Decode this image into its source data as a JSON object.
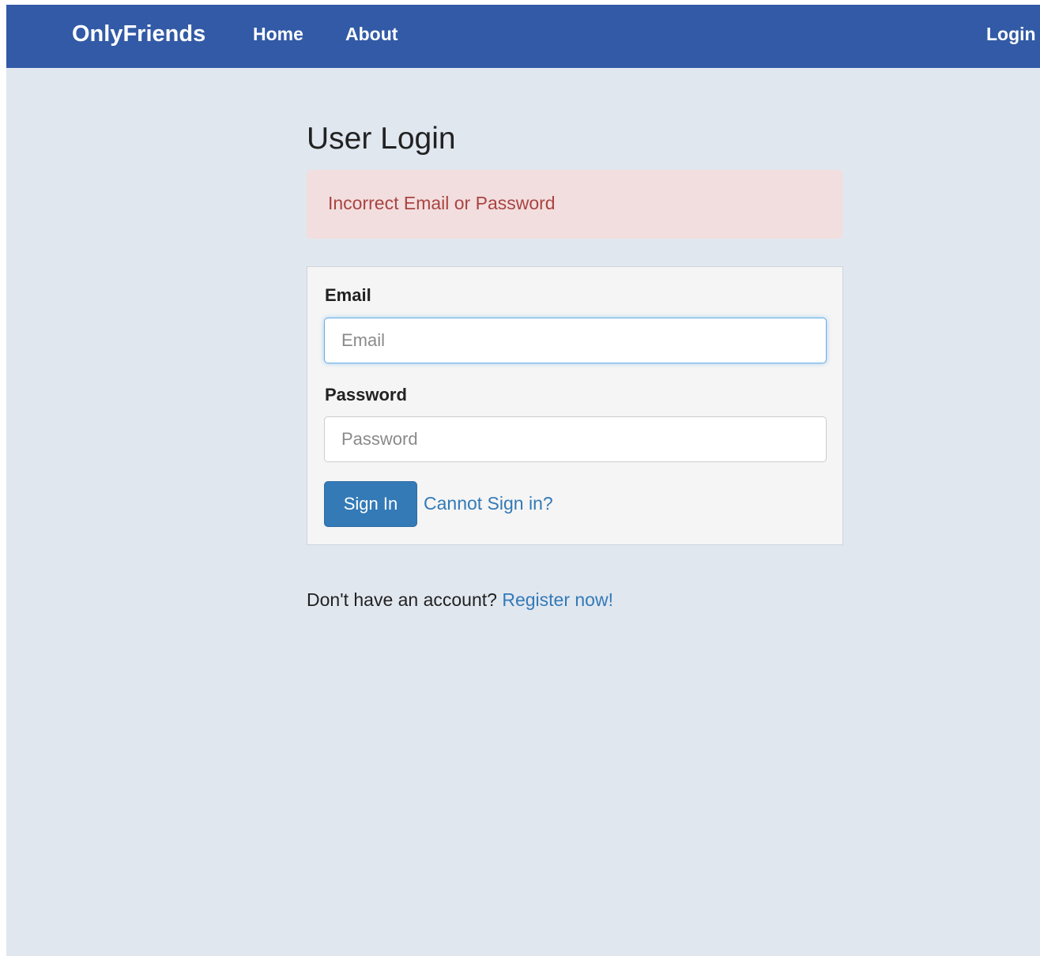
{
  "navbar": {
    "brand": "OnlyFriends",
    "links": [
      {
        "label": "Home"
      },
      {
        "label": "About"
      }
    ],
    "login_label": "Login"
  },
  "page": {
    "title": "User Login"
  },
  "alert": {
    "message": "Incorrect Email or Password"
  },
  "form": {
    "email_label": "Email",
    "email_placeholder": "Email",
    "email_value": "",
    "password_label": "Password",
    "password_placeholder": "Password",
    "password_value": "",
    "signin_label": "Sign In",
    "help_link": "Cannot Sign in?"
  },
  "register": {
    "prompt": "Don't have an account? ",
    "link": "Register now!"
  },
  "colors": {
    "navbar": "#325aa6",
    "background": "#e1e7ef",
    "alert_bg": "#f2dede",
    "alert_text": "#a94442",
    "primary": "#337ab7"
  }
}
